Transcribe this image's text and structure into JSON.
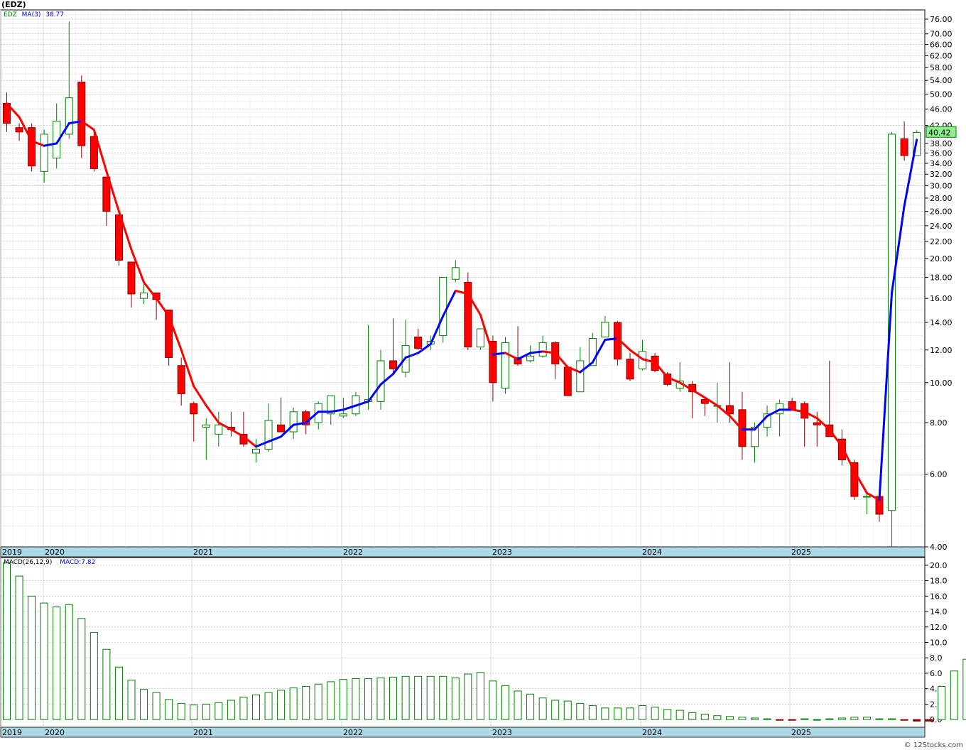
{
  "title": "(EDZ)",
  "price_panel": {
    "symbol": "EDZ",
    "ma_label": "MA(3)",
    "ma_value": "38.77",
    "last_price": "40.42"
  },
  "macd_panel": {
    "label": "MACD(26,12,9)",
    "value_label": "MACD:7.82"
  },
  "watermark": "© 12Stocks.com",
  "colors": {
    "up": "#008000",
    "down": "#ff0000",
    "ma_up": "#0000ff",
    "ma_down": "#ff0000",
    "axis_band": "#add8e6",
    "grid": "#b0b0b0",
    "last_price_bg": "#90ee90"
  },
  "chart_data": [
    {
      "type": "candlestick",
      "scale": "log",
      "ylim": [
        4,
        80
      ],
      "y_ticks": [
        "4.00",
        "6.00",
        "8.00",
        "10.00",
        "12.00",
        "14.00",
        "16.00",
        "18.00",
        "20.00",
        "22.00",
        "24.00",
        "26.00",
        "28.00",
        "30.00",
        "32.00",
        "34.00",
        "36.00",
        "38.00",
        "42.00",
        "46.00",
        "50.00",
        "54.00",
        "58.00",
        "62.00",
        "66.00",
        "70.00",
        "76.00"
      ],
      "x_labels": [
        "2019",
        "2020",
        "2021",
        "2022",
        "2023",
        "2024",
        "2025"
      ],
      "series": [
        {
          "name": "EDZ",
          "ohlc": [
            [
              47.5,
              50.5,
              40.5,
              42.5
            ],
            [
              41.5,
              42.5,
              38.5,
              40.5
            ],
            [
              41.5,
              42.5,
              32.5,
              33.5
            ],
            [
              32.5,
              41.0,
              30.5,
              40.0
            ],
            [
              35.0,
              47.5,
              33.0,
              43.0
            ],
            [
              40.0,
              75.0,
              39.0,
              49.0
            ],
            [
              53.5,
              55.5,
              35.0,
              37.5
            ],
            [
              39.5,
              41.0,
              32.5,
              33.0
            ],
            [
              31.5,
              31.5,
              24.0,
              26.0
            ],
            [
              25.5,
              25.5,
              19.2,
              19.8
            ],
            [
              19.6,
              19.6,
              15.2,
              16.4
            ],
            [
              16.0,
              17.5,
              15.5,
              16.5
            ],
            [
              16.5,
              16.5,
              14.2,
              15.9
            ],
            [
              15.0,
              15.0,
              11.0,
              11.5
            ],
            [
              11.0,
              11.5,
              8.8,
              9.4
            ],
            [
              8.9,
              9.0,
              7.2,
              8.4
            ],
            [
              7.8,
              8.2,
              6.5,
              7.9
            ],
            [
              7.5,
              8.5,
              7.0,
              7.9
            ],
            [
              7.8,
              8.5,
              7.4,
              7.7
            ],
            [
              7.5,
              8.5,
              7.0,
              7.1
            ],
            [
              6.75,
              7.3,
              6.4,
              6.9
            ],
            [
              6.9,
              8.9,
              6.8,
              8.1
            ],
            [
              7.9,
              9.2,
              7.7,
              7.6
            ],
            [
              7.6,
              8.7,
              7.3,
              8.5
            ],
            [
              8.5,
              8.6,
              7.5,
              7.9
            ],
            [
              8.0,
              9.0,
              7.7,
              8.9
            ],
            [
              8.4,
              9.2,
              7.9,
              9.3
            ],
            [
              8.3,
              9.2,
              8.2,
              8.4
            ],
            [
              8.4,
              9.5,
              8.3,
              9.3
            ],
            [
              9.0,
              13.8,
              8.6,
              9.1
            ],
            [
              9.0,
              12.0,
              8.6,
              11.3
            ],
            [
              11.3,
              14.3,
              10.5,
              10.8
            ],
            [
              10.6,
              14.2,
              10.3,
              12.3
            ],
            [
              12.9,
              13.5,
              12.0,
              12.1
            ],
            [
              12.4,
              13.0,
              12.0,
              12.6
            ],
            [
              13.0,
              17.8,
              12.5,
              18.0
            ],
            [
              17.8,
              19.8,
              17.5,
              19.0
            ],
            [
              17.5,
              18.5,
              12.0,
              12.2
            ],
            [
              12.2,
              13.5,
              12.0,
              13.5
            ],
            [
              12.6,
              13.0,
              9.0,
              10.0
            ],
            [
              9.7,
              12.9,
              9.4,
              12.5
            ],
            [
              11.5,
              13.7,
              11.0,
              11.1
            ],
            [
              11.3,
              12.3,
              11.2,
              11.6
            ],
            [
              11.6,
              13.0,
              11.5,
              12.5
            ],
            [
              12.5,
              12.6,
              10.2,
              11.1
            ],
            [
              10.9,
              11.0,
              9.3,
              9.3
            ],
            [
              9.5,
              12.2,
              9.5,
              11.3
            ],
            [
              11.0,
              13.2,
              11.0,
              12.8
            ],
            [
              12.9,
              14.5,
              12.9,
              14.0
            ],
            [
              14.0,
              14.1,
              11.0,
              11.4
            ],
            [
              11.4,
              11.8,
              10.1,
              10.2
            ],
            [
              10.8,
              12.7,
              10.7,
              11.9
            ],
            [
              11.6,
              11.8,
              10.6,
              10.7
            ],
            [
              10.5,
              10.6,
              9.8,
              9.9
            ],
            [
              9.7,
              11.2,
              9.5,
              10.1
            ],
            [
              9.9,
              10.1,
              8.2,
              9.5
            ],
            [
              9.1,
              9.2,
              8.3,
              8.9
            ],
            [
              8.8,
              10.0,
              8.0,
              8.8
            ],
            [
              8.8,
              11.2,
              8.0,
              8.4
            ],
            [
              8.6,
              9.5,
              6.5,
              7.0
            ],
            [
              7.0,
              8.0,
              6.4,
              7.8
            ],
            [
              7.8,
              8.8,
              7.4,
              8.4
            ],
            [
              8.4,
              9.1,
              7.4,
              8.9
            ],
            [
              9.0,
              9.2,
              8.6,
              8.6
            ],
            [
              8.9,
              9.0,
              7.0,
              8.2
            ],
            [
              8.0,
              8.5,
              7.0,
              7.9
            ],
            [
              7.9,
              11.3,
              7.4,
              7.4
            ],
            [
              7.3,
              7.7,
              6.3,
              6.5
            ],
            [
              6.4,
              6.5,
              5.2,
              5.3
            ],
            [
              5.3,
              5.4,
              4.8,
              5.3
            ],
            [
              5.3,
              5.4,
              4.6,
              4.8
            ],
            [
              4.9,
              40.5,
              4.0,
              40.0
            ],
            [
              39.0,
              43.0,
              34.5,
              35.5
            ],
            [
              35.5,
              40.9,
              35.5,
              40.4
            ]
          ]
        },
        {
          "name": "MA(3)",
          "values": [
            47.5,
            44.0,
            38.5,
            37.5,
            38.0,
            42.5,
            43.0,
            41.0,
            32.5,
            26.0,
            21.0,
            17.5,
            16.0,
            14.5,
            12.0,
            9.8,
            8.8,
            8.0,
            7.7,
            7.4,
            7.0,
            7.2,
            7.4,
            7.9,
            8.0,
            8.5,
            8.5,
            8.6,
            8.8,
            9.0,
            9.9,
            10.5,
            11.5,
            11.8,
            12.4,
            14.5,
            16.7,
            16.4,
            14.6,
            11.7,
            11.8,
            11.4,
            11.8,
            11.9,
            11.8,
            10.9,
            10.6,
            11.2,
            12.7,
            12.8,
            12.0,
            11.4,
            11.2,
            10.3,
            10.0,
            9.6,
            9.2,
            8.8,
            8.3,
            7.7,
            7.7,
            8.3,
            8.6,
            8.6,
            8.5,
            8.2,
            7.7,
            7.0,
            6.1,
            5.4,
            5.2,
            16.5,
            26.8,
            38.77
          ]
        }
      ]
    },
    {
      "type": "bar",
      "x_labels": [
        "2019",
        "2020",
        "2021",
        "2022",
        "2023",
        "2024",
        "2025"
      ],
      "ylim": [
        -1,
        21
      ],
      "y_ticks": [
        "0.0",
        "2.0",
        "4.0",
        "6.0",
        "8.0",
        "10.0",
        "12.0",
        "14.0",
        "16.0",
        "18.0",
        "20.0"
      ],
      "series": [
        {
          "name": "MACD(26,12,9)",
          "values": [
            20.3,
            18.6,
            16.0,
            15.1,
            14.6,
            14.9,
            13.1,
            11.3,
            9.1,
            6.8,
            5.1,
            3.9,
            3.5,
            2.6,
            2.1,
            1.9,
            2.0,
            2.2,
            2.5,
            2.9,
            3.2,
            3.5,
            3.8,
            4.1,
            4.3,
            4.6,
            4.9,
            5.2,
            5.3,
            5.3,
            5.4,
            5.5,
            5.6,
            5.6,
            5.6,
            5.6,
            5.4,
            5.9,
            6.1,
            5.0,
            4.4,
            3.7,
            3.3,
            2.8,
            2.5,
            2.4,
            2.1,
            1.8,
            1.5,
            1.5,
            1.5,
            1.8,
            1.6,
            1.3,
            1.2,
            0.9,
            0.7,
            0.5,
            0.4,
            0.3,
            0.2,
            0.1,
            -0.1,
            -0.1,
            0.1,
            0.0,
            0.1,
            0.2,
            0.3,
            0.3,
            0.1,
            0.1,
            -0.1,
            -0.2,
            -0.2,
            4.3,
            6.3,
            7.82
          ]
        }
      ]
    }
  ]
}
